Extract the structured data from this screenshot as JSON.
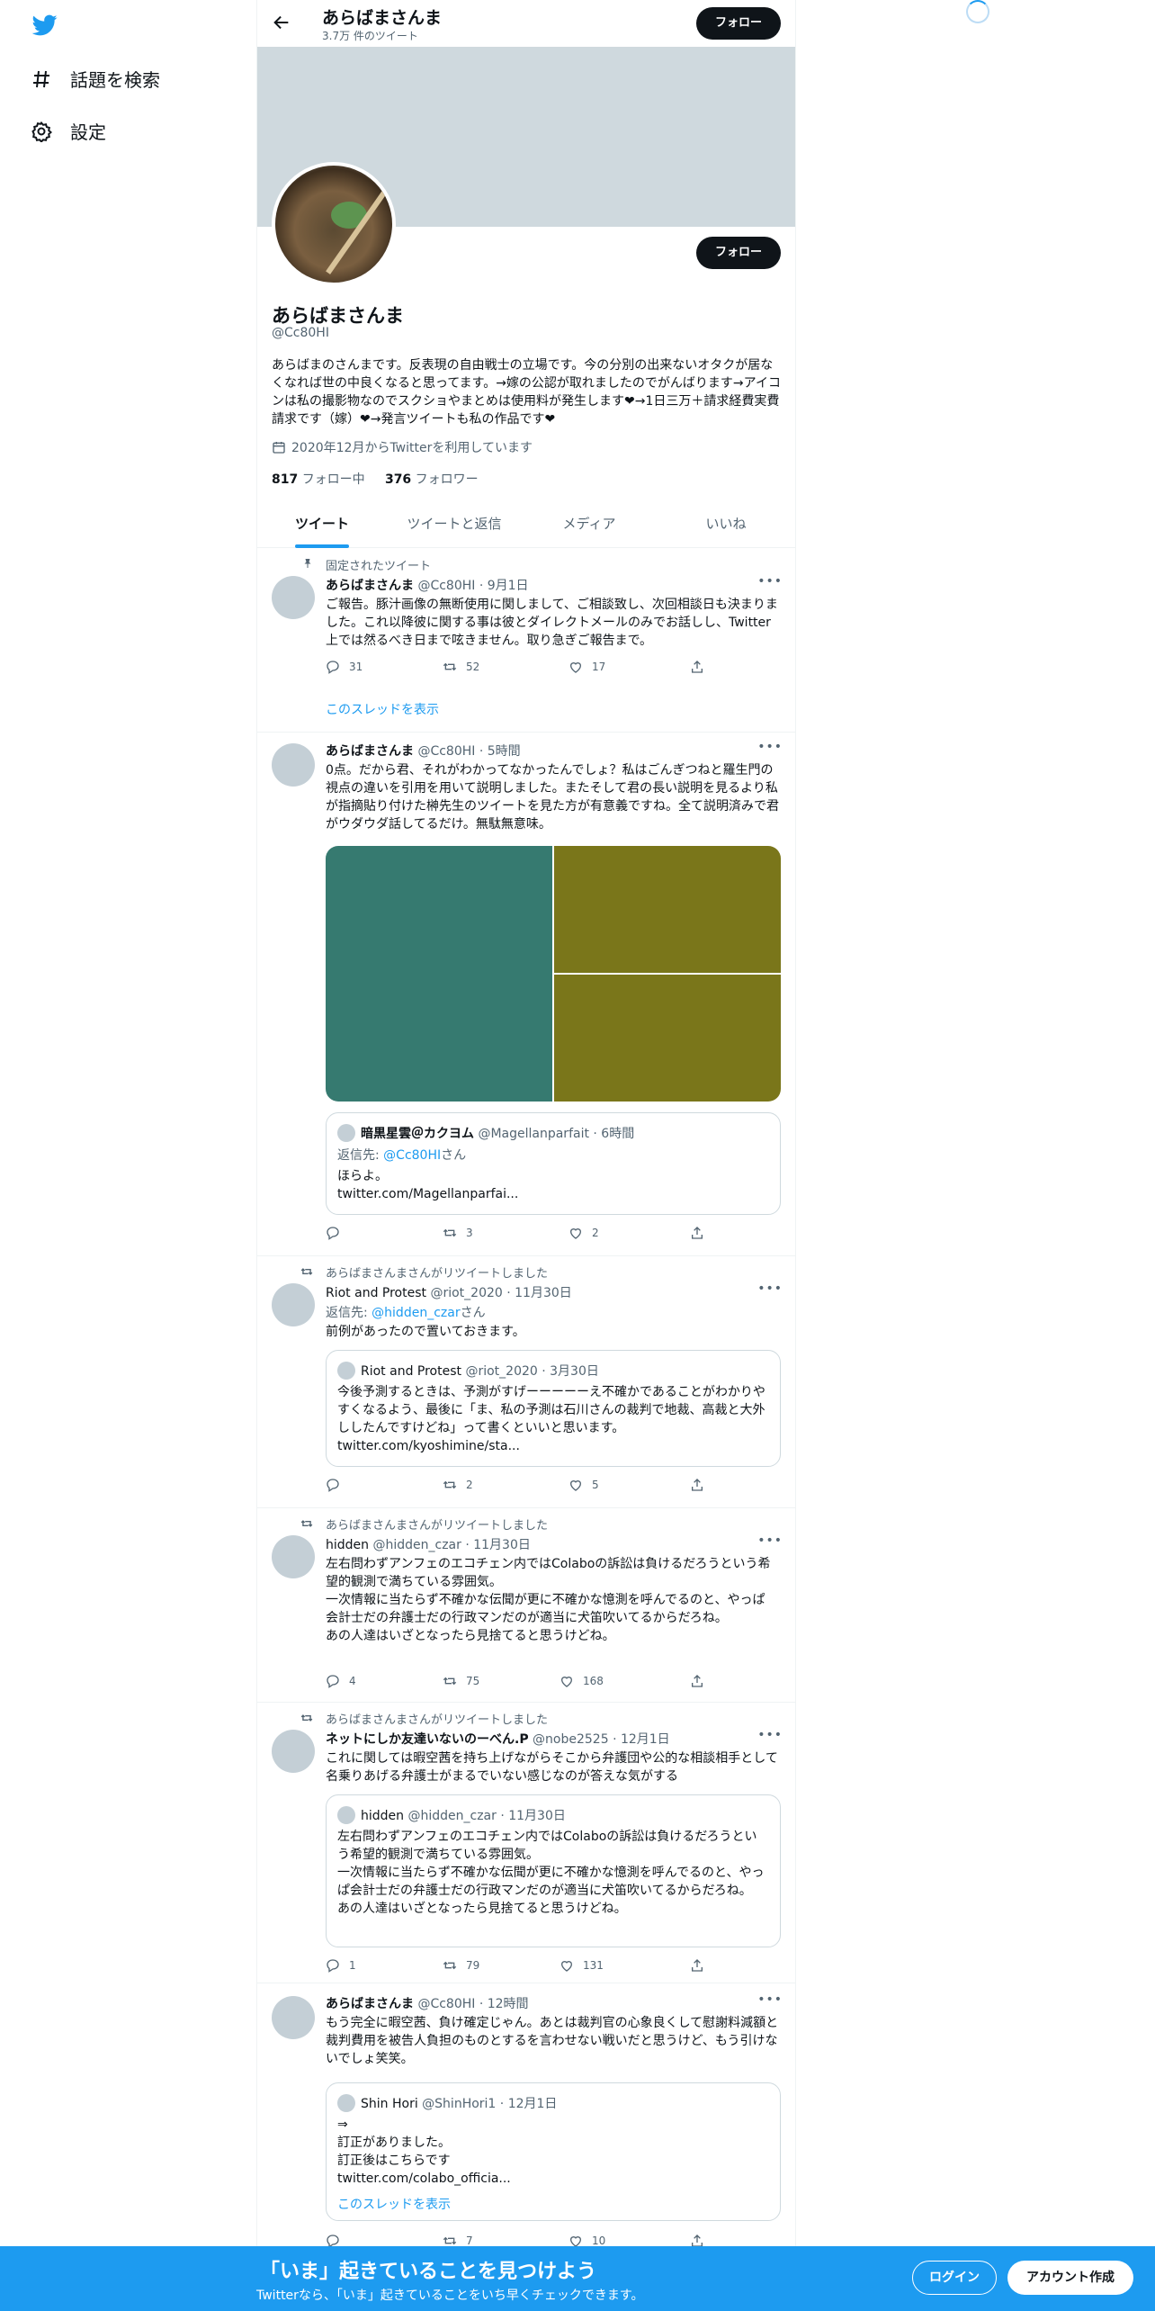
{
  "sidebar": {
    "logo": "twitter-bird-icon",
    "items": [
      {
        "label": "話題を検索",
        "icon": "hashtag-icon"
      },
      {
        "label": "設定",
        "icon": "gear-icon"
      }
    ]
  },
  "header": {
    "name": "あらばまさんま",
    "tweet_count": "3.7万 件のツイート",
    "follow_label": "フォロー"
  },
  "profile": {
    "name": "あらばまさんま",
    "handle": "@Cc80HI",
    "follow_label": "フォロー",
    "bio": "あらばまのさんまです。反表現の自由戦士の立場です。今の分別の出来ないオタクが居なくなれば世の中良くなると思ってます。→嫁の公認が取れましたのでがんばります→アイコンは私の撮影物なのでスクショやまとめは使用料が発生します❤→1日三万＋請求経費実費請求です（嫁）❤→発言ツイートも私の作品です❤",
    "joined": "2020年12月からTwitterを利用しています",
    "following_count": "817",
    "following_label": "フォロー中",
    "followers_count": "376",
    "followers_label": "フォロワー"
  },
  "tabs": [
    "ツイート",
    "ツイートと返信",
    "メディア",
    "いいね"
  ],
  "tweets": [
    {
      "context": "固定されたツイート",
      "name": "あらばまさんま",
      "handle": "@Cc80HI · 9月1日",
      "text": "ご報告。豚汁画像の無断使用に関しまして、ご相談致し、次回相談日も決まりました。これ以降彼に関する事は彼とダイレクトメールのみでお話しし、Twitter上では然るべき日まで呟きません。取り急ぎご報告まで。",
      "replies": "31",
      "retweets": "52",
      "likes": "17",
      "show_thread": "このスレッドを表示"
    },
    {
      "name": "あらばまさんま",
      "handle": "@Cc80HI · 5時間",
      "text": "0点。だから君、それがわかってなかったんでしょ？私はごんぎつねと羅生門の視点の違いを引用を用いて説明しました。またそして君の長い説明を見るより私が指摘貼り付けた榊先生のツイートを見た方が有意義ですね。全て説明済みで君がウダウダ話してるだけ。無駄無意味。",
      "media_colors": [
        "#367a70",
        "#7a761a",
        "#7a761a"
      ],
      "quote": {
        "name": "暗黒星雲＠カクヨム",
        "handle": "@Magellanparfait · 6時間",
        "reply_prefix": "返信先: ",
        "reply_to": "@Cc80HI",
        "reply_suffix": "さん",
        "text": "ほらよ。\ntwitter.com/Magellanparfai..."
      },
      "replies": "",
      "retweets": "3",
      "likes": "2"
    },
    {
      "context": "あらばまさんまさんがリツイートしました",
      "name": "Riot and Protest",
      "handle": "@riot_2020 · 11月30日",
      "reply_prefix": "返信先: ",
      "reply_to": "@hidden_czar",
      "reply_suffix": "さん",
      "text": "前例があったので置いておきます。",
      "quote": {
        "name": "Riot and Protest",
        "handle": "@riot_2020 · 3月30日",
        "text": "今後予測するときは、予測がすげーーーーーえ不確かであることがわかりやすくなるよう、最後に「ま、私の予測は石川さんの裁判で地裁、高裁と大外ししたんですけどね」って書くといいと思います。\ntwitter.com/kyoshimine/sta..."
      },
      "replies": "",
      "retweets": "2",
      "likes": "5"
    },
    {
      "context": "あらばまさんまさんがリツイートしました",
      "name": "hidden",
      "handle": "@hidden_czar · 11月30日",
      "text": "左右問わずアンフェのエコチェン内ではColaboの訴訟は負けるだろうという希望的観測で満ちている雰囲気。\n一次情報に当たらず不確かな伝聞が更に不確かな憶測を呼んでるのと、やっぱ会計士だの弁護士だの行政マンだのが適当に犬笛吹いてるからだろね。\nあの人達はいざとなったら見捨てると思うけどね。",
      "replies": "4",
      "retweets": "75",
      "likes": "168"
    },
    {
      "context": "あらばまさんまさんがリツイートしました",
      "name": "ネットにしか友達いないのーべん.P",
      "handle": "@nobe2525 · 12月1日",
      "text": "これに関しては暇空茜を持ち上げながらそこから弁護団や公的な相談相手として名乗りあげる弁護士がまるでいない感じなのが答えな気がする",
      "quote": {
        "name": "hidden",
        "handle": "@hidden_czar · 11月30日",
        "text": "左右問わずアンフェのエコチェン内ではColaboの訴訟は負けるだろうという希望的観測で満ちている雰囲気。\n一次情報に当たらず不確かな伝聞が更に不確かな憶測を呼んでるのと、やっぱ会計士だの弁護士だの行政マンだのが適当に犬笛吹いてるからだろね。\nあの人達はいざとなったら見捨てると思うけどね。"
      },
      "replies": "1",
      "retweets": "79",
      "likes": "131"
    },
    {
      "name": "あらばまさんま",
      "handle": "@Cc80HI · 12時間",
      "text": "もう完全に暇空茜、負け確定じゃん。あとは裁判官の心象良くして慰謝料減額と裁判費用を被告人負担のものとするを言わせない戦いだと思うけど、もう引けないでしょ笑笑。",
      "quote": {
        "name": "Shin Hori",
        "handle": "@ShinHori1 · 12月1日",
        "text": "⇒\n訂正がありました。\n訂正後はこちらです\ntwitter.com/colabo_officia...",
        "show_thread": "このスレッドを表示"
      },
      "replies": "",
      "retweets": "7",
      "likes": "10"
    }
  ],
  "bottom_bar": {
    "title": "「いま」起きていることを見つけよう",
    "subtitle": "Twitterなら、「いま」起きていることをいち早くチェックできます。",
    "login": "ログイン",
    "signup": "アカウント作成"
  },
  "colors": {
    "accent": "#1d9bf0",
    "text": "#0f1419",
    "secondary": "#536471"
  }
}
